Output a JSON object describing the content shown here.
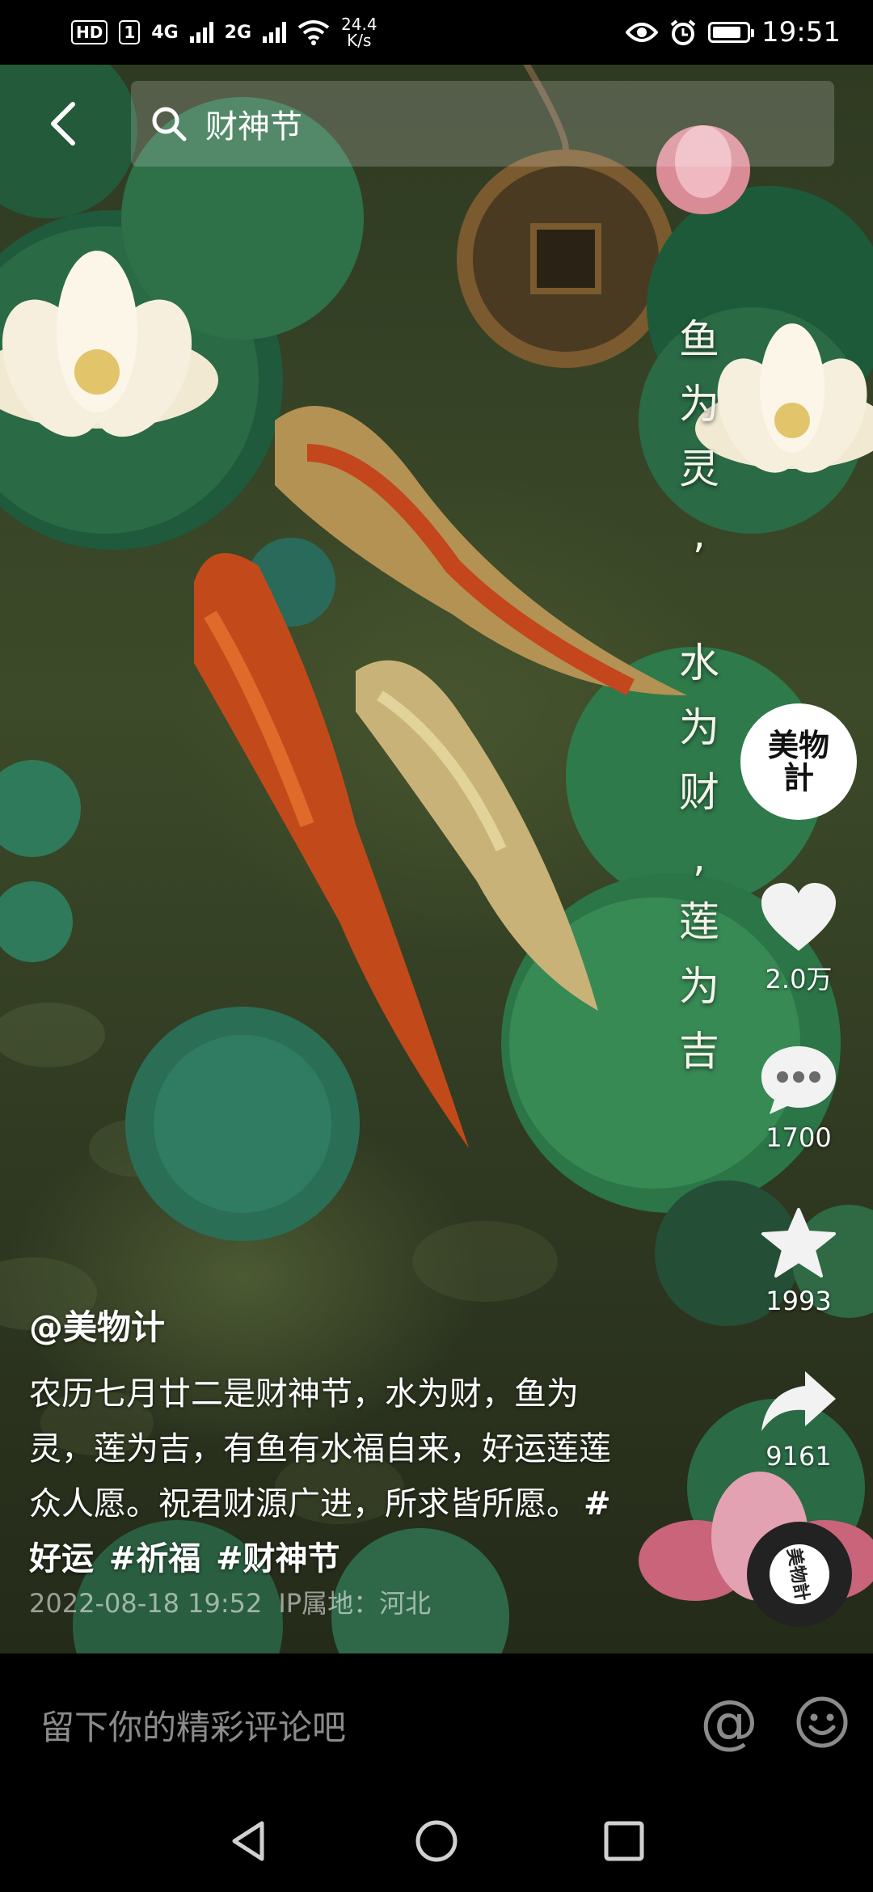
{
  "status_bar": {
    "hd_label": "HD",
    "sim_label": "1",
    "net1": "4G",
    "net2": "2G",
    "speed_value": "24.4",
    "speed_unit": "K/s",
    "time": "19:51",
    "battery_level": 0.85
  },
  "search": {
    "query": "财神节"
  },
  "video": {
    "poem": "鱼\n为\n灵\n,\n\n水\n为\n财\n,\n莲\n为\n吉"
  },
  "sidebar": {
    "avatar_text": "美物計",
    "like_count": "2.0万",
    "comment_count": "1700",
    "favorite_count": "1993",
    "share_count": "9161"
  },
  "caption": {
    "author": "@美物计",
    "description": "农历七月廿二是财神节，水为财，鱼为灵，莲为吉，有鱼有水福自来，好运莲莲众人愿。祝君财源广进，所求皆所愿。",
    "hashtags": [
      "#好运",
      "#祈福",
      "#财神节"
    ],
    "timestamp": "2022-08-18 19:52",
    "location": "IP属地：河北"
  },
  "comment_bar": {
    "placeholder": "留下你的精彩评论吧",
    "at_symbol": "@"
  },
  "music": {
    "disc_text": "美物計"
  },
  "icons": {
    "back": "back-arrow-icon",
    "search": "search-icon",
    "like": "heart-icon",
    "comment": "comment-icon",
    "favorite": "star-icon",
    "share": "share-icon",
    "emoji": "emoji-icon"
  },
  "colors": {
    "background": "#000000",
    "overlay_text": "#ffffff",
    "muted_text": "#8b8b8b"
  }
}
